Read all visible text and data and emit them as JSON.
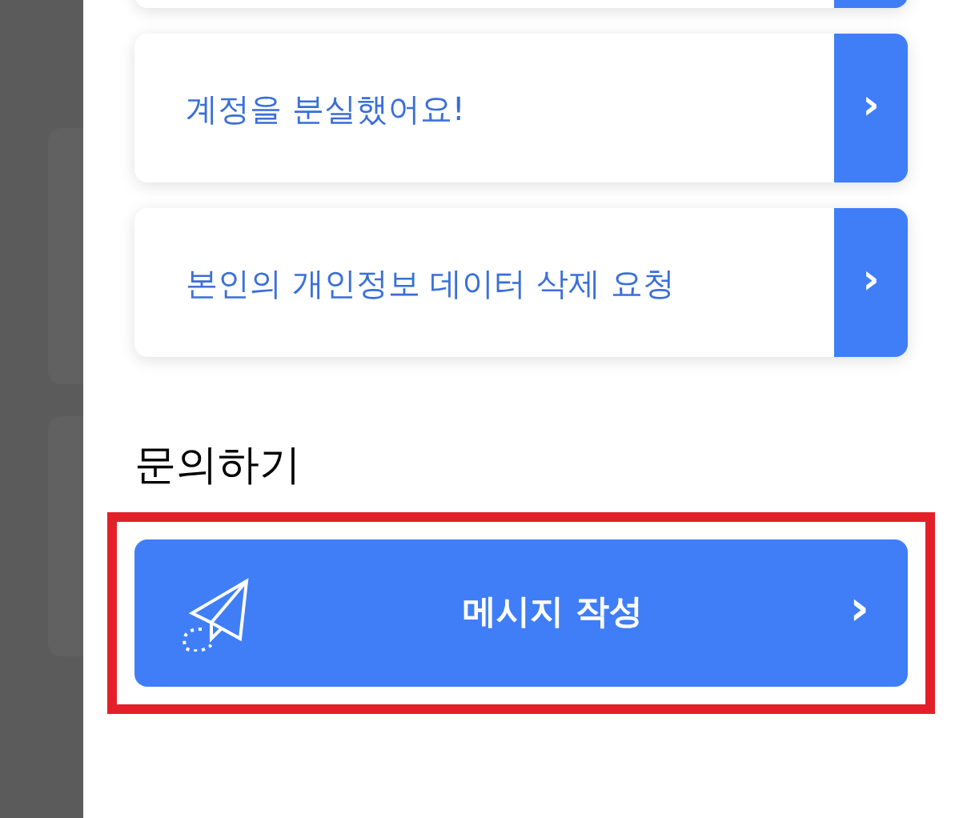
{
  "faq_items": [
    {
      "kind": "partial"
    },
    {
      "kind": "full",
      "label": "계정을 분실했어요!"
    },
    {
      "kind": "full",
      "label": "본인의 개인정보 데이터 삭제 요청"
    }
  ],
  "contact_section": {
    "title": "문의하기",
    "button": {
      "label": "메시지 작성",
      "arrow": "›"
    }
  },
  "chevron": "›"
}
